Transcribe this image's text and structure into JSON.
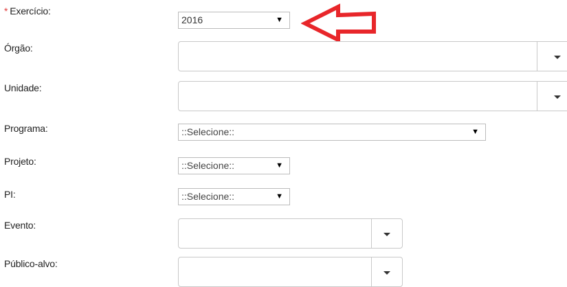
{
  "fields": {
    "exercicio": {
      "required_mark": "*",
      "label": "Exercício:",
      "value": "2016"
    },
    "orgao": {
      "label": "Órgão:",
      "value": ""
    },
    "unidade": {
      "label": "Unidade:",
      "value": ""
    },
    "programa": {
      "label": "Programa:",
      "value": "::Selecione::"
    },
    "projeto": {
      "label": "Projeto:",
      "value": "::Selecione::"
    },
    "pi": {
      "label": "PI:",
      "value": "::Selecione::"
    },
    "evento": {
      "label": "Evento:",
      "value": ""
    },
    "publico_alvo": {
      "label": "Público-alvo:",
      "value": ""
    }
  },
  "icons": {
    "dropdown_arrow": "▼",
    "annotation_arrow": "left-arrow-outline"
  },
  "colors": {
    "annotation": "#e8262a",
    "required": "#e03a3a",
    "border": "#c8c8c8"
  }
}
